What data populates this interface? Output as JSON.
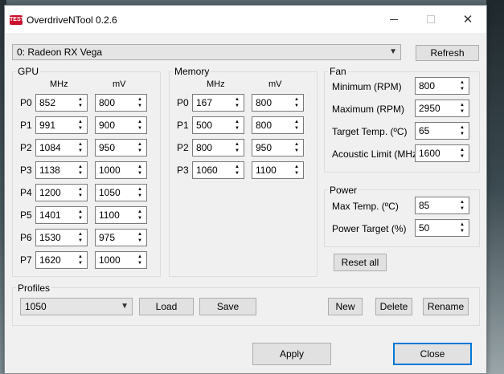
{
  "window": {
    "title": "OverdriveNTool 0.2.6",
    "icon_label": "TEST"
  },
  "device": {
    "selected": "0: Radeon RX Vega",
    "refresh_label": "Refresh"
  },
  "gpu": {
    "title": "GPU",
    "col_mhz": "MHz",
    "col_mv": "mV",
    "states": [
      {
        "label": "P0",
        "mhz": "852",
        "mv": "800"
      },
      {
        "label": "P1",
        "mhz": "991",
        "mv": "900"
      },
      {
        "label": "P2",
        "mhz": "1084",
        "mv": "950"
      },
      {
        "label": "P3",
        "mhz": "1138",
        "mv": "1000"
      },
      {
        "label": "P4",
        "mhz": "1200",
        "mv": "1050"
      },
      {
        "label": "P5",
        "mhz": "1401",
        "mv": "1100"
      },
      {
        "label": "P6",
        "mhz": "1530",
        "mv": "975"
      },
      {
        "label": "P7",
        "mhz": "1620",
        "mv": "1000"
      }
    ]
  },
  "memory": {
    "title": "Memory",
    "col_mhz": "MHz",
    "col_mv": "mV",
    "states": [
      {
        "label": "P0",
        "mhz": "167",
        "mv": "800"
      },
      {
        "label": "P1",
        "mhz": "500",
        "mv": "800"
      },
      {
        "label": "P2",
        "mhz": "800",
        "mv": "950"
      },
      {
        "label": "P3",
        "mhz": "1060",
        "mv": "1100"
      }
    ]
  },
  "fan": {
    "title": "Fan",
    "rows": [
      {
        "label": "Minimum (RPM)",
        "value": "800"
      },
      {
        "label": "Maximum (RPM)",
        "value": "2950"
      },
      {
        "label": "Target Temp. (ºC)",
        "value": "65"
      },
      {
        "label": "Acoustic Limit (MHz)",
        "value": "1600"
      }
    ]
  },
  "power": {
    "title": "Power",
    "rows": [
      {
        "label": "Max Temp. (ºC)",
        "value": "85"
      },
      {
        "label": "Power Target (%)",
        "value": "50"
      }
    ]
  },
  "reset_label": "Reset all",
  "profiles": {
    "title": "Profiles",
    "selected": "1050",
    "load_label": "Load",
    "save_label": "Save",
    "new_label": "New",
    "delete_label": "Delete",
    "rename_label": "Rename"
  },
  "footer": {
    "apply_label": "Apply",
    "close_label": "Close"
  },
  "colors": {
    "accent": "#0078d7",
    "window_bg": "#f0f0f0",
    "app_icon": "#c8102e"
  }
}
